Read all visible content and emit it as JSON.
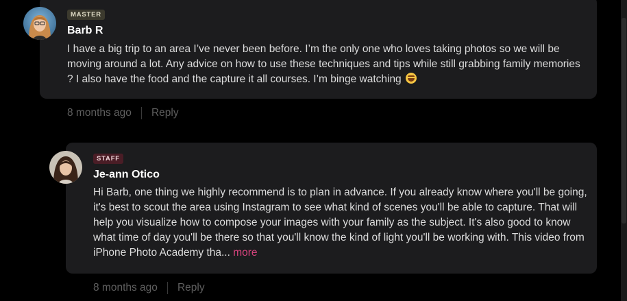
{
  "comments": [
    {
      "badge": "MASTER",
      "author": "Barb R",
      "text": "I have a big trip to an area I’ve never been before. I’m the only one who loves taking photos so we will be moving around a lot. Any advice on how to use these techniques and tips while still grabbing family memories ? I also have the food and the capture it all courses. I’m binge watching",
      "emoji": "laughing-with-tears-emoji",
      "timestamp": "8 months ago",
      "reply_label": "Reply"
    },
    {
      "badge": "STAFF",
      "author": "Je-ann Otico",
      "text": "Hi Barb, one thing we highly recommend is to plan in advance. If you already know where you'll be going, it's best to scout the area using Instagram to see what kind of scenes you'll be able to capture. That will help you visualize how to compose your images with your family as the subject. It's also good to know what time of day you'll be there so that you'll know the kind of light you'll be working with. This video from iPhone Photo Academy tha...",
      "more_label": "more",
      "timestamp": "8 months ago",
      "reply_label": "Reply"
    }
  ],
  "colors": {
    "background": "#000000",
    "card": "#1c1c1e",
    "master_badge": "#3c3a2e",
    "staff_badge": "#4a1d26",
    "link": "#d6437d",
    "meta": "#5f5f5f"
  }
}
